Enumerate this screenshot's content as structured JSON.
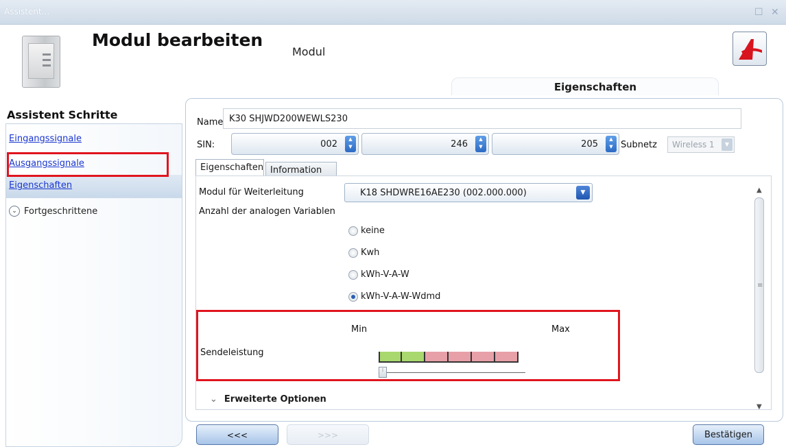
{
  "window": {
    "title": "Assistent...",
    "maximize_glyph": "☐",
    "close_glyph": "✕"
  },
  "header": {
    "title": "Modul bearbeiten",
    "subtitle": "Modul",
    "tab": "Eigenschaften"
  },
  "sidebar": {
    "title": "Assistent Schritte",
    "steps": [
      {
        "label": "Eingangssignale"
      },
      {
        "label": "Ausgangssignale"
      },
      {
        "label": "Eigenschaften"
      },
      {
        "label": "Fortgeschrittene"
      }
    ]
  },
  "form": {
    "name_label": "Name",
    "name_value": "K30 SHJWD200WEWLS230",
    "sin_label": "SIN:",
    "sin_values": [
      "002",
      "246",
      "205"
    ],
    "subnetz_label": "Subnetz",
    "subnetz_value": "Wireless 1"
  },
  "tabs": [
    {
      "label": "Eigenschaften"
    },
    {
      "label": "Information"
    }
  ],
  "properties": {
    "forwarding_label": "Modul für Weiterleitung",
    "forwarding_value": "K18 SHDWRE16AE230 (002.000.000)",
    "analog_label": "Anzahl der analogen Variablen",
    "radio_options": [
      "keine",
      "Kwh",
      "kWh-V-A-W",
      "kWh-V-A-W-Wdmd"
    ],
    "radio_selected": "kWh-V-A-W-Wdmd",
    "power_min": "Min",
    "power_max": "Max",
    "power_label": "Sendeleistung",
    "power_level_fraction": 0,
    "advanced_label": "Erweiterte Optionen"
  },
  "footer": {
    "back_label": "<<<",
    "next_label": ">>>",
    "confirm_label": "Bestätigen"
  },
  "colors": {
    "highlight": "#e0141e",
    "link": "#1a36cf",
    "accent": "#2d6bc4"
  }
}
